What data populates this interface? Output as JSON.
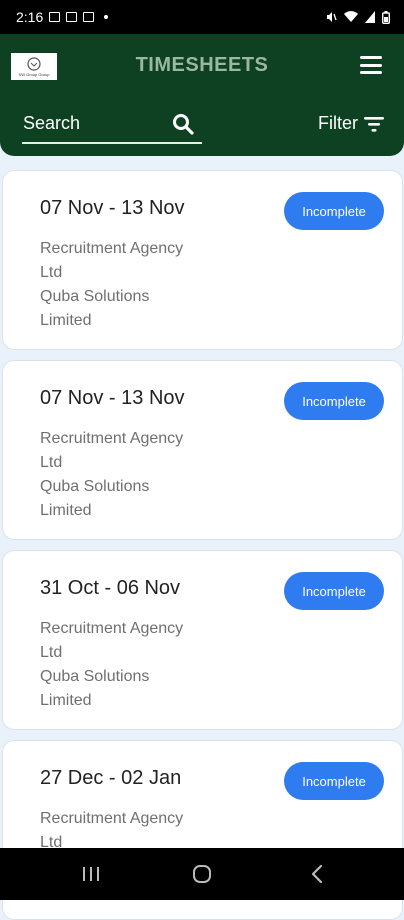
{
  "status_bar": {
    "time": "2:16"
  },
  "header": {
    "logo_text": "SW Group Group",
    "title": "TIMESHEETS"
  },
  "search": {
    "label": "Search"
  },
  "filter": {
    "label": "Filter"
  },
  "timesheets": [
    {
      "date_range": "07 Nov - 13 Nov",
      "agency_line1": "Recruitment Agency",
      "agency_line2": "Ltd",
      "client_line1": "Quba Solutions",
      "client_line2": "Limited",
      "status": "Incomplete"
    },
    {
      "date_range": "07 Nov - 13 Nov",
      "agency_line1": "Recruitment Agency",
      "agency_line2": "Ltd",
      "client_line1": "Quba Solutions",
      "client_line2": "Limited",
      "status": "Incomplete"
    },
    {
      "date_range": "31 Oct - 06 Nov",
      "agency_line1": "Recruitment Agency",
      "agency_line2": "Ltd",
      "client_line1": "Quba Solutions",
      "client_line2": "Limited",
      "status": "Incomplete"
    },
    {
      "date_range": "27 Dec - 02 Jan",
      "agency_line1": "Recruitment Agency",
      "agency_line2": "Ltd",
      "client_line1": "",
      "client_line2": "",
      "status": "Incomplete"
    }
  ],
  "colors": {
    "header_bg": "#0d4121",
    "badge_bg": "#2f7bf0",
    "page_bg": "#e9f1fb"
  },
  "icons": [
    "wifi-icon",
    "signal-icon",
    "battery-icon",
    "search-icon",
    "filter-icon",
    "menu-icon",
    "recents-icon",
    "home-icon",
    "back-icon"
  ]
}
